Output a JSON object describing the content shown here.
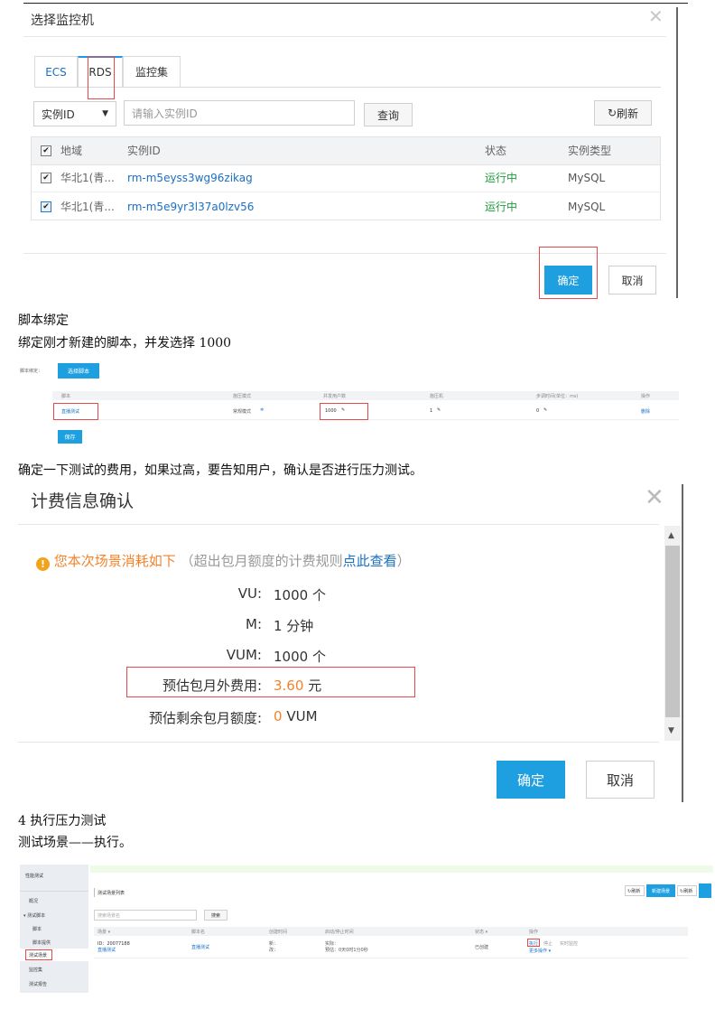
{
  "panel1": {
    "title": "选择监控机",
    "tabs": [
      "ECS",
      "RDS",
      "监控集"
    ],
    "select_value": "实例ID",
    "search_placeholder": "请输入实例ID",
    "query_label": "查询",
    "refresh_label": "刷新",
    "columns": [
      "地域",
      "实例ID",
      "状态",
      "实例类型"
    ],
    "rows": [
      {
        "region": "华北1(青...",
        "id": "rm-m5eyss3wg96zikag",
        "status": "运行中",
        "type": "MySQL"
      },
      {
        "region": "华北1(青...",
        "id": "rm-m5e9yr3l37a0lzv56",
        "status": "运行中",
        "type": "MySQL"
      }
    ],
    "confirm_label": "确定",
    "cancel_label": "取消"
  },
  "doc": {
    "heading1": "脚本绑定",
    "text1": "绑定刚才新建的脚本，并发选择 1000",
    "text2": "确定一下测试的费用，如果过高，要告知用户，确认是否进行压力测试。",
    "heading2": "4  执行压力测试",
    "text3": "测试场景——执行。"
  },
  "panel2": {
    "label": "脚本绑定：",
    "select_button": "选择脚本",
    "columns": [
      "脚本",
      "施压模式",
      "并发用户数",
      "施压机",
      "步调时间(单位：ms)",
      "操作"
    ],
    "row": {
      "script": "直播测试",
      "mode": "常规模式",
      "users": "1000",
      "machines": "1",
      "pace": "0",
      "op": "删除"
    },
    "save_button": "保存"
  },
  "panel3": {
    "title": "计费信息确认",
    "notice_prefix": "您本次场景消耗如下",
    "notice_paren_open": "（超出包月额度的计费规则",
    "notice_link": "点此查看",
    "notice_paren_close": "）",
    "rows": [
      {
        "label": "VU:",
        "value": "1000 个"
      },
      {
        "label": "M:",
        "value": "1 分钟"
      },
      {
        "label": "VUM:",
        "value": "1000 个"
      }
    ],
    "fee_label": "预估包月外费用:",
    "fee_value": "3.60",
    "fee_unit": "元",
    "quota_label": "预估剩余包月额度:",
    "quota_value": "0",
    "quota_unit": "VUM",
    "confirm_label": "确定",
    "cancel_label": "取消"
  },
  "panel4": {
    "app_title": "性能测试",
    "sidebar": [
      "概况",
      "测试脚本",
      "脚本",
      "脚本提供",
      "测试场景",
      "监控集",
      "测试报告"
    ],
    "list_title": "测试场景列表",
    "search_placeholder": "搜索场景名",
    "search_button": "搜索",
    "columns": [
      "场景 ▾",
      "脚本名",
      "创建时间",
      "启动/停止时间",
      "状态 ▾",
      "操作"
    ],
    "row": {
      "scene_id": "ID：20077188",
      "scene_name": "直播测试",
      "script": "直播测试",
      "created_1": "新：",
      "created_2": "改：",
      "start_1": "实际：",
      "start_2": "预估：0天0时1分0秒",
      "status": "已创建",
      "op_run": "执行",
      "op_stop": "停止",
      "op_monitor": "实时监控",
      "op_more": "更多操作 ▾"
    },
    "refresh_labels": [
      "刷新",
      "刷新"
    ],
    "create_label": "新建场景"
  }
}
